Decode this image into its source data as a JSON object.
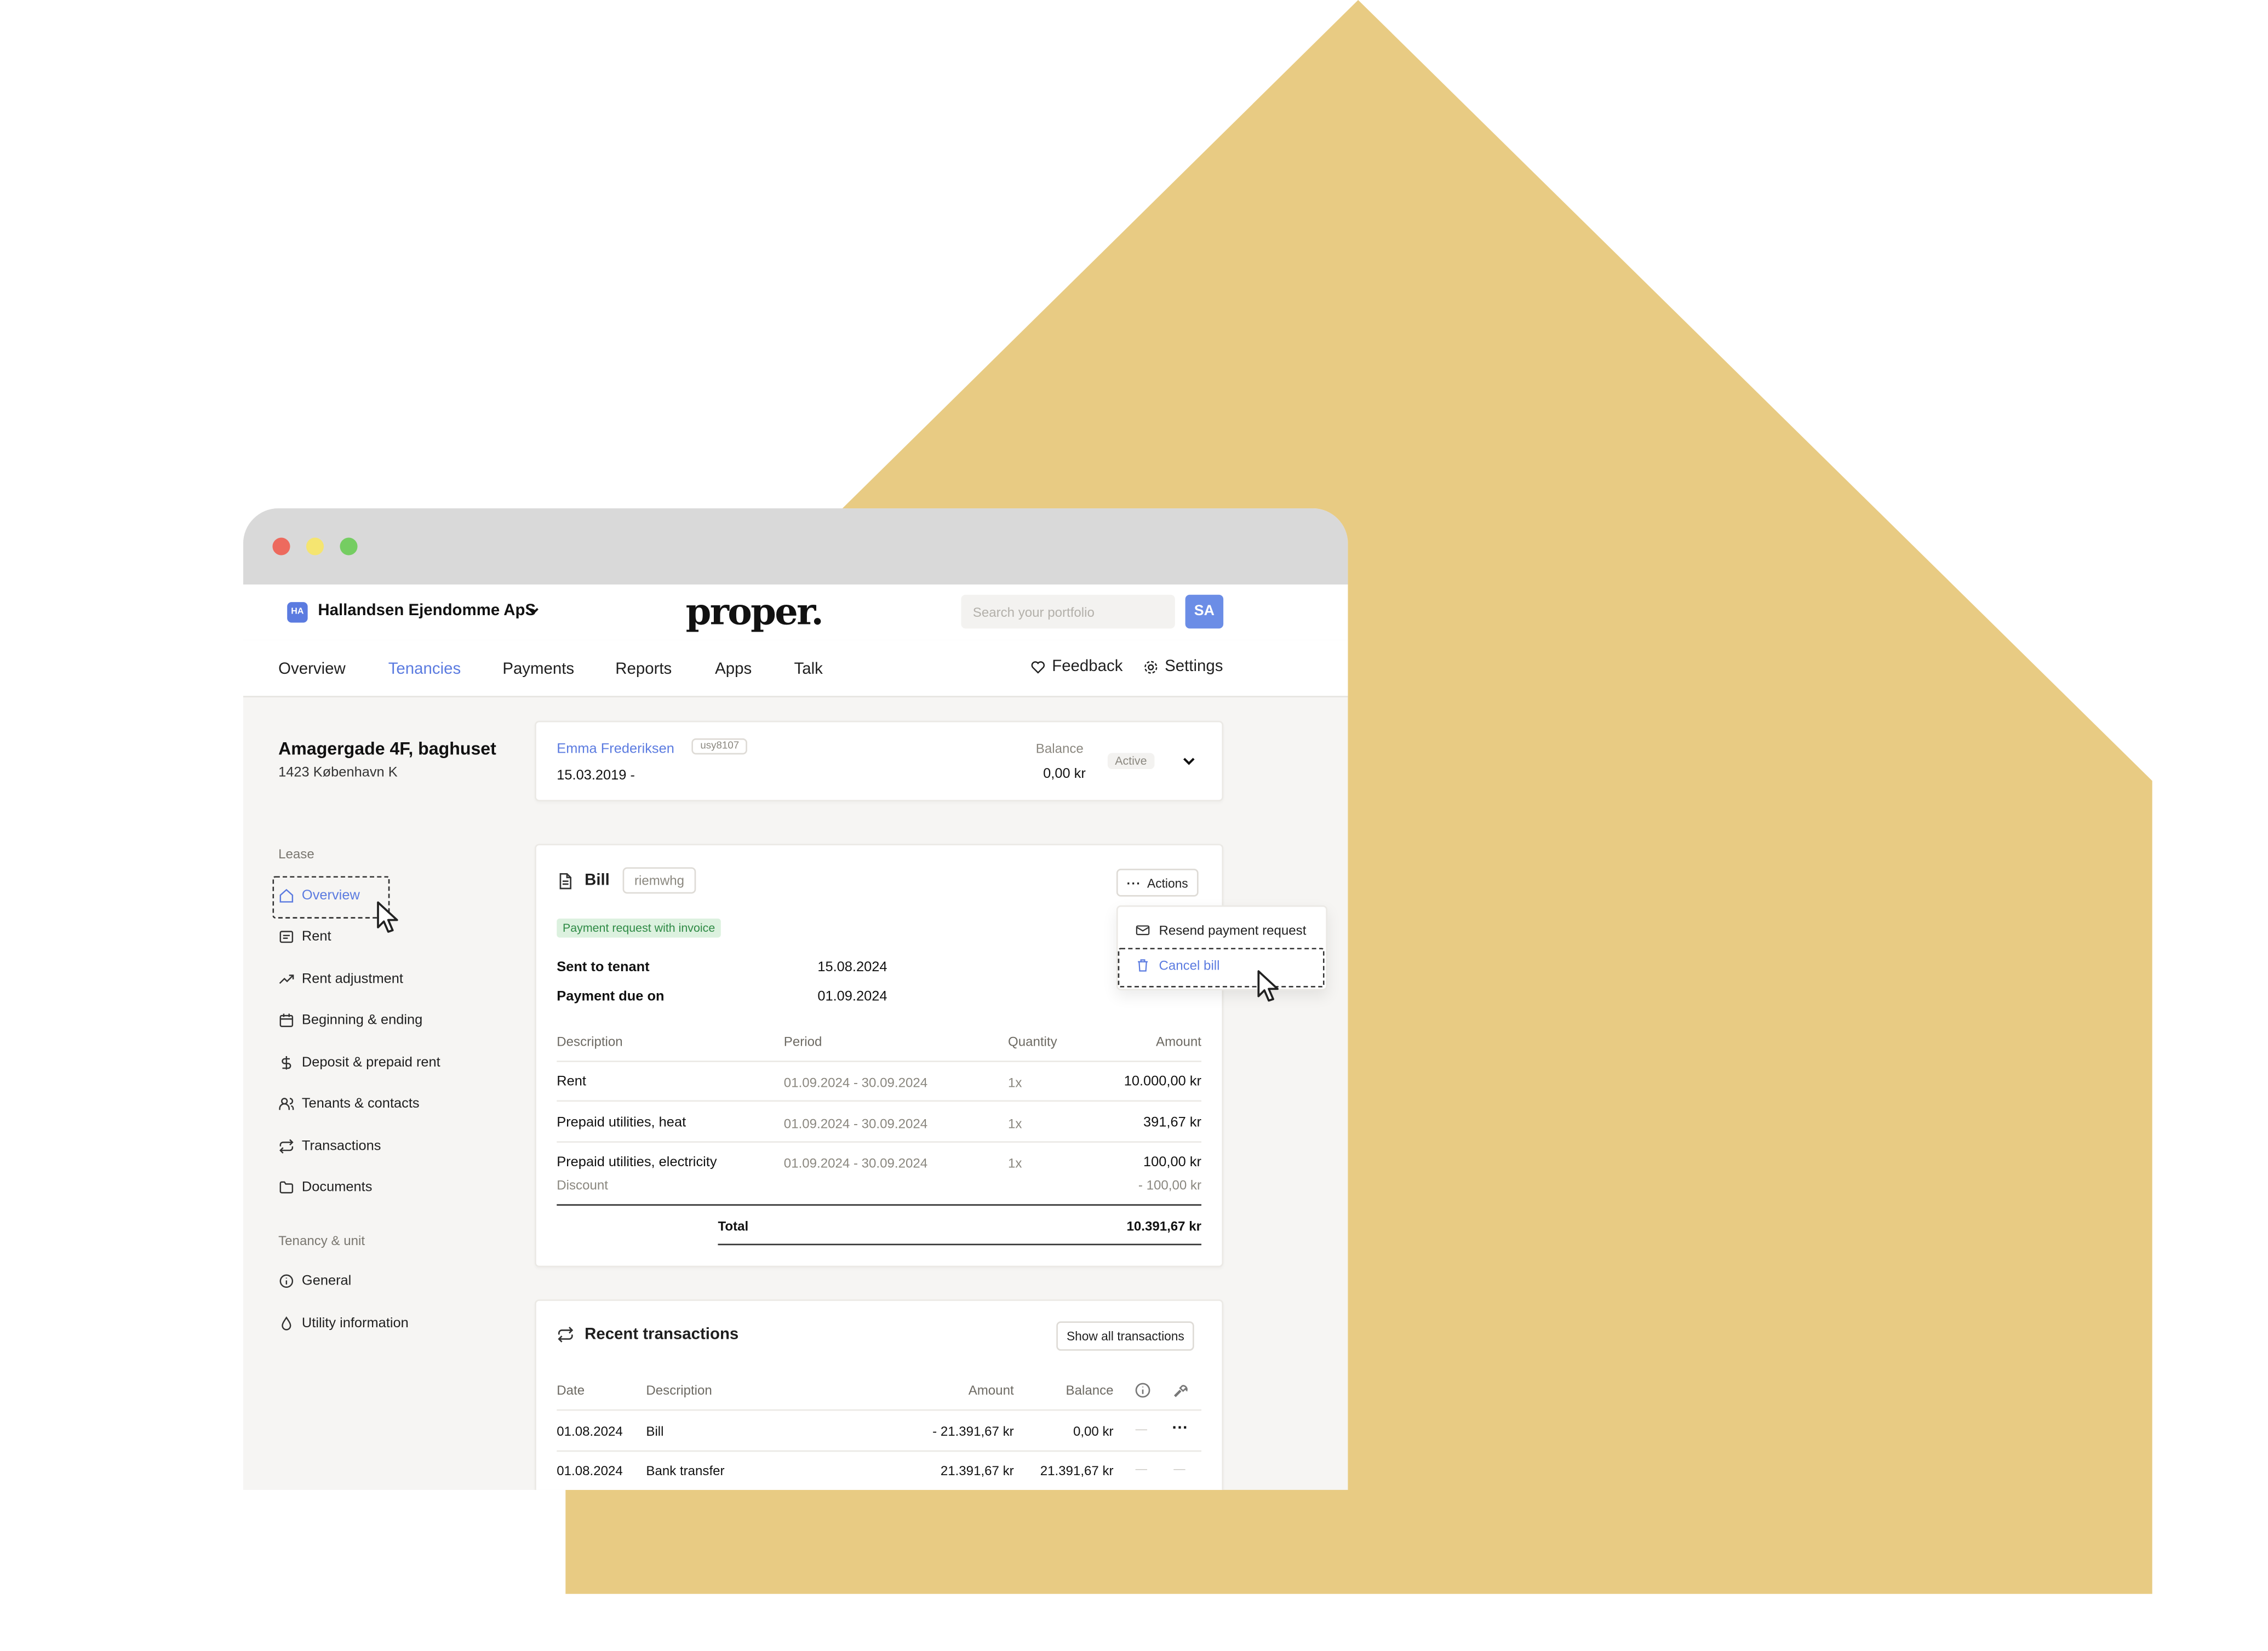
{
  "colors": {
    "house": "#e8cb83",
    "accent": "#5b7be0",
    "titlebar": "#d9d9d9"
  },
  "header": {
    "org_badge": "HA",
    "org_name": "Hallandsen Ejendomme ApS",
    "logo": "proper.",
    "search_placeholder": "Search your portfolio",
    "avatar": "SA"
  },
  "nav": {
    "items": [
      "Overview",
      "Tenancies",
      "Payments",
      "Reports",
      "Apps",
      "Talk"
    ],
    "active": "Tenancies",
    "feedback": "Feedback",
    "settings": "Settings"
  },
  "property": {
    "title": "Amagergade 4F, baghuset",
    "subtitle": "1423 København K"
  },
  "sidebar": {
    "lease_heading": "Lease",
    "lease_items": [
      {
        "label": "Overview",
        "icon": "home-icon",
        "active": true
      },
      {
        "label": "Rent",
        "icon": "receipt-icon"
      },
      {
        "label": "Rent adjustment",
        "icon": "trending-up-icon"
      },
      {
        "label": "Beginning & ending",
        "icon": "calendar-icon"
      },
      {
        "label": "Deposit & prepaid rent",
        "icon": "dollar-icon"
      },
      {
        "label": "Tenants & contacts",
        "icon": "users-icon"
      },
      {
        "label": "Transactions",
        "icon": "repeat-icon"
      },
      {
        "label": "Documents",
        "icon": "folder-icon"
      }
    ],
    "unit_heading": "Tenancy & unit",
    "unit_items": [
      {
        "label": "General",
        "icon": "info-icon"
      },
      {
        "label": "Utility information",
        "icon": "drop-icon"
      }
    ]
  },
  "tenant": {
    "name": "Emma Frederiksen",
    "id_chip": "usy8107",
    "start": "15.03.2019 -",
    "balance_label": "Balance",
    "balance_value": "0,00 kr",
    "status": "Active"
  },
  "bill": {
    "title": "Bill",
    "id_chip": "riemwhg",
    "actions_label": "Actions",
    "type_badge": "Payment request with invoice",
    "sent_label": "Sent to tenant",
    "sent_value": "15.08.2024",
    "due_label": "Payment due on",
    "due_value": "01.09.2024",
    "columns": [
      "Description",
      "Period",
      "Quantity",
      "Amount"
    ],
    "rows": [
      {
        "description": "Rent",
        "period": "01.09.2024 - 30.09.2024",
        "quantity": "1x",
        "amount": "10.000,00 kr"
      },
      {
        "description": "Prepaid utilities, heat",
        "period": "01.09.2024 - 30.09.2024",
        "quantity": "1x",
        "amount": "391,67 kr"
      },
      {
        "description": "Prepaid utilities, electricity",
        "period": "01.09.2024 - 30.09.2024",
        "quantity": "1x",
        "amount": "100,00 kr"
      }
    ],
    "discount_label": "Discount",
    "discount_value": "- 100,00 kr",
    "total_label": "Total",
    "total_value": "10.391,67 kr"
  },
  "actions_menu": {
    "items": [
      {
        "label": "Resend payment request",
        "icon": "mail-icon"
      },
      {
        "label": "Cancel bill",
        "icon": "trash-icon"
      }
    ]
  },
  "transactions": {
    "title": "Recent transactions",
    "show_all": "Show all transactions",
    "columns": [
      "Date",
      "Description",
      "Amount",
      "Balance"
    ],
    "rows": [
      {
        "date": "01.08.2024",
        "description": "Bill",
        "amount": "- 21.391,67 kr",
        "balance": "0,00 kr",
        "col5": "—",
        "col6": "···"
      },
      {
        "date": "01.08.2024",
        "description": "Bank transfer",
        "amount": "21.391,67 kr",
        "balance": "21.391,67 kr",
        "col5": "—",
        "col6": "—"
      }
    ]
  }
}
